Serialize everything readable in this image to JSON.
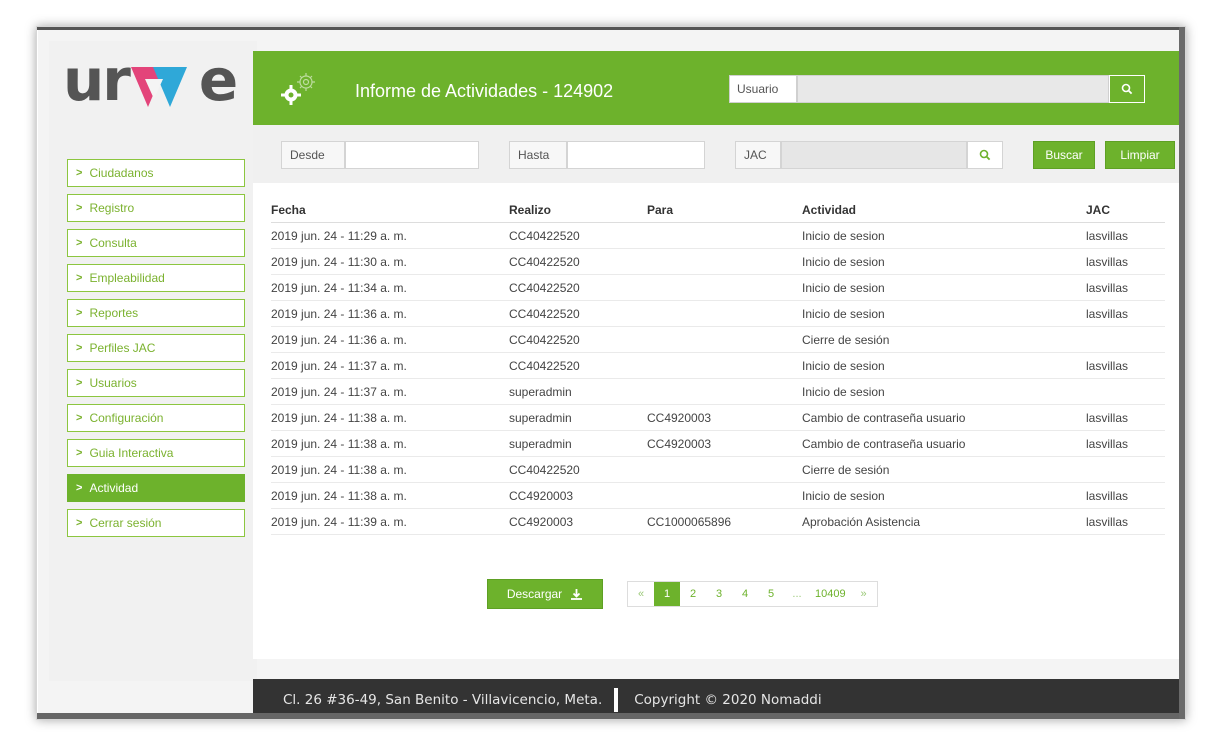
{
  "logo": {
    "text_left": "ur",
    "text_right": "e"
  },
  "sidebar": {
    "items": [
      {
        "label": "Ciudadanos"
      },
      {
        "label": "Registro"
      },
      {
        "label": "Consulta"
      },
      {
        "label": "Empleabilidad"
      },
      {
        "label": "Reportes"
      },
      {
        "label": "Perfiles JAC"
      },
      {
        "label": "Usuarios"
      },
      {
        "label": "Configuración"
      },
      {
        "label": "Guia Interactiva"
      },
      {
        "label": "Actividad",
        "active": true
      },
      {
        "label": "Cerrar sesión"
      }
    ]
  },
  "header": {
    "title": "Informe de Actividades - 124902",
    "user_label": "Usuario",
    "user_value": "",
    "search_icon": "search-icon"
  },
  "filters": {
    "desde_label": "Desde",
    "desde_value": "",
    "hasta_label": "Hasta",
    "hasta_value": "",
    "jac_label": "JAC",
    "jac_value": "",
    "buscar_label": "Buscar",
    "limpiar_label": "Limpiar"
  },
  "table": {
    "headers": [
      "Fecha",
      "Realizo",
      "Para",
      "Actividad",
      "JAC"
    ],
    "rows": [
      [
        "2019 jun. 24 - 11:29 a. m.",
        "CC40422520",
        "",
        "Inicio de sesion",
        "lasvillas"
      ],
      [
        "2019 jun. 24 - 11:30 a. m.",
        "CC40422520",
        "",
        "Inicio de sesion",
        "lasvillas"
      ],
      [
        "2019 jun. 24 - 11:34 a. m.",
        "CC40422520",
        "",
        "Inicio de sesion",
        "lasvillas"
      ],
      [
        "2019 jun. 24 - 11:36 a. m.",
        "CC40422520",
        "",
        "Inicio de sesion",
        "lasvillas"
      ],
      [
        "2019 jun. 24 - 11:36 a. m.",
        "CC40422520",
        "",
        "Cierre de sesión",
        ""
      ],
      [
        "2019 jun. 24 - 11:37 a. m.",
        "CC40422520",
        "",
        "Inicio de sesion",
        "lasvillas"
      ],
      [
        "2019 jun. 24 - 11:37 a. m.",
        "superadmin",
        "",
        "Inicio de sesion",
        ""
      ],
      [
        "2019 jun. 24 - 11:38 a. m.",
        "superadmin",
        "CC4920003",
        "Cambio de contraseña usuario",
        "lasvillas"
      ],
      [
        "2019 jun. 24 - 11:38 a. m.",
        "superadmin",
        "CC4920003",
        "Cambio de contraseña usuario",
        "lasvillas"
      ],
      [
        "2019 jun. 24 - 11:38 a. m.",
        "CC40422520",
        "",
        "Cierre de sesión",
        ""
      ],
      [
        "2019 jun. 24 - 11:38 a. m.",
        "CC4920003",
        "",
        "Inicio de sesion",
        "lasvillas"
      ],
      [
        "2019 jun. 24 - 11:39 a. m.",
        "CC4920003",
        "CC1000065896",
        "Aprobación Asistencia",
        "lasvillas"
      ]
    ]
  },
  "download": {
    "label": "Descargar",
    "icon": "download-icon"
  },
  "pagination": {
    "prev": "«",
    "pages": [
      "1",
      "2",
      "3",
      "4",
      "5",
      "...",
      "10409"
    ],
    "active": "1",
    "next": "»"
  },
  "footer": {
    "address": "Cl. 26 #36-49, San Benito - Villavicencio, Meta.",
    "copyright": "Copyright © 2020 Nomaddi"
  },
  "colors": {
    "brand_green": "#6db22c",
    "footer_bg": "#333333",
    "logo_pink": "#e3447a",
    "logo_blue": "#2fa8d8"
  }
}
